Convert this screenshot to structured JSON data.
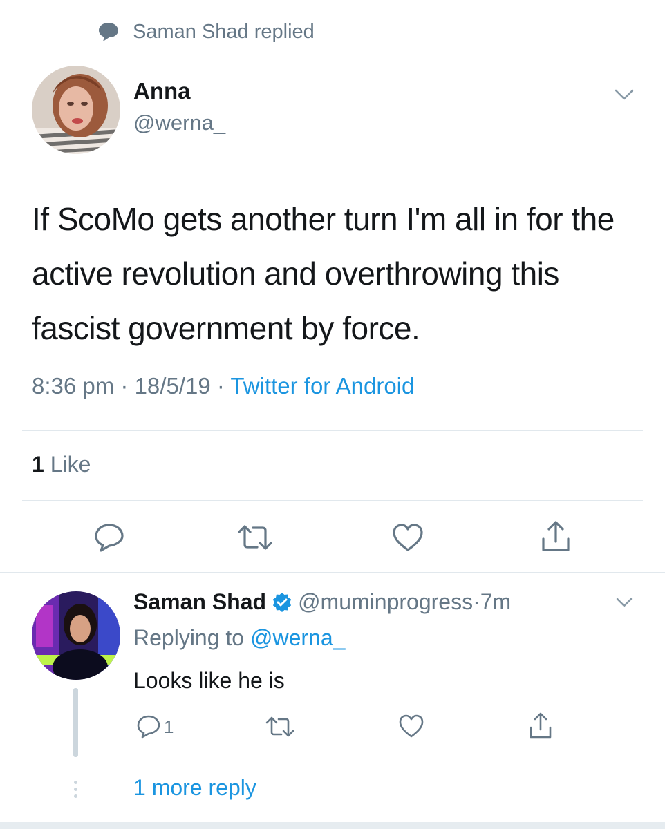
{
  "context": {
    "icon": "speech-bubble-icon",
    "text": "Saman Shad replied"
  },
  "tweet": {
    "author_name": "Anna",
    "author_handle": "@werna_",
    "text": "If ScoMo gets another turn I'm all in for the active revolution and overthrowing this fascist government by force.",
    "time": "8:36 pm",
    "sep1": " · ",
    "date": "18/5/19",
    "sep2": " · ",
    "source": "Twitter for Android",
    "like_count": "1",
    "like_label": "Like"
  },
  "reply": {
    "author_name": "Saman Shad",
    "author_handle": "@muminprogress",
    "time_sep": " · ",
    "time": "7m",
    "replying_prefix": "Replying to ",
    "replying_handle": "@werna_",
    "text": "Looks like he is",
    "reply_count": "1",
    "more_replies": "1 more reply"
  },
  "colors": {
    "accent": "#1b95e0",
    "muted": "#657786",
    "text": "#14171a",
    "divider": "#e1e8ed"
  }
}
